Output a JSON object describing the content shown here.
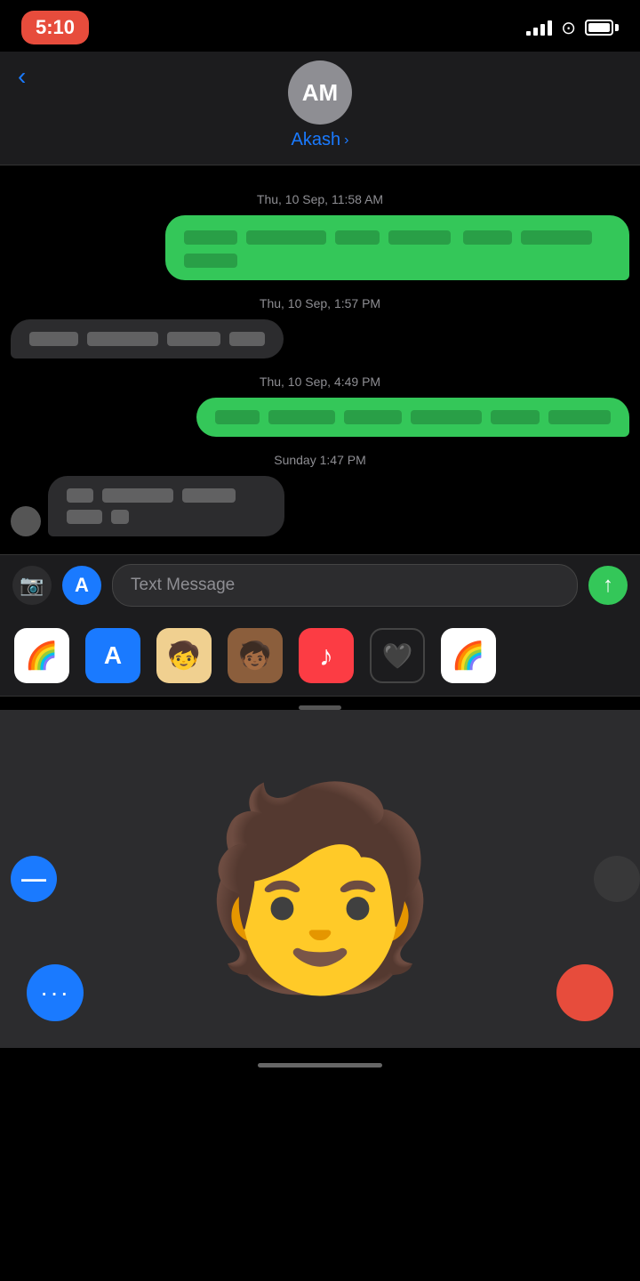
{
  "statusBar": {
    "time": "5:10",
    "signalDot": "·"
  },
  "header": {
    "avatarInitials": "AM",
    "contactName": "Akash",
    "backLabel": "‹"
  },
  "messages": [
    {
      "timestamp": "Thu, 10 Sep, 11:58 AM",
      "bubbles": [
        {
          "type": "sent",
          "blurWidths": [
            60,
            90,
            50,
            70,
            55,
            80,
            60
          ]
        }
      ]
    },
    {
      "timestamp": "Thu, 10 Sep, 1:57 PM",
      "bubbles": [
        {
          "type": "received",
          "blurWidths": [
            55,
            80,
            60,
            70
          ]
        }
      ]
    },
    {
      "timestamp": "Thu, 10 Sep, 4:49 PM",
      "bubbles": [
        {
          "type": "sent",
          "blurWidths": [
            50,
            75,
            65,
            80,
            55,
            70
          ]
        }
      ]
    },
    {
      "timestamp": "Sunday 1:47 PM",
      "bubbles": [
        {
          "type": "received_avatar",
          "blurWidths": [
            30,
            80,
            60,
            40,
            20
          ]
        }
      ]
    }
  ],
  "inputBar": {
    "cameraLabel": "📷",
    "appStoreLabel": "A",
    "placeholder": "Text Message",
    "sendArrow": "↑"
  },
  "appPicker": {
    "apps": [
      {
        "id": "photos",
        "label": "🌈",
        "style": "photos"
      },
      {
        "id": "appstore",
        "label": "A",
        "style": "appstore"
      },
      {
        "id": "memoji1",
        "label": "🧒",
        "style": "memoji1"
      },
      {
        "id": "memoji2",
        "label": "🧒",
        "style": "memoji2"
      },
      {
        "id": "music",
        "label": "♪",
        "style": "music"
      },
      {
        "id": "hearts",
        "label": "🖤",
        "style": "hearts"
      },
      {
        "id": "photos2",
        "label": "🌈",
        "style": "photos2"
      }
    ]
  },
  "memojiArea": {
    "emoji": "🧑",
    "moreLabel": "···",
    "sideLeftLabel": "—"
  },
  "homeIndicator": {}
}
